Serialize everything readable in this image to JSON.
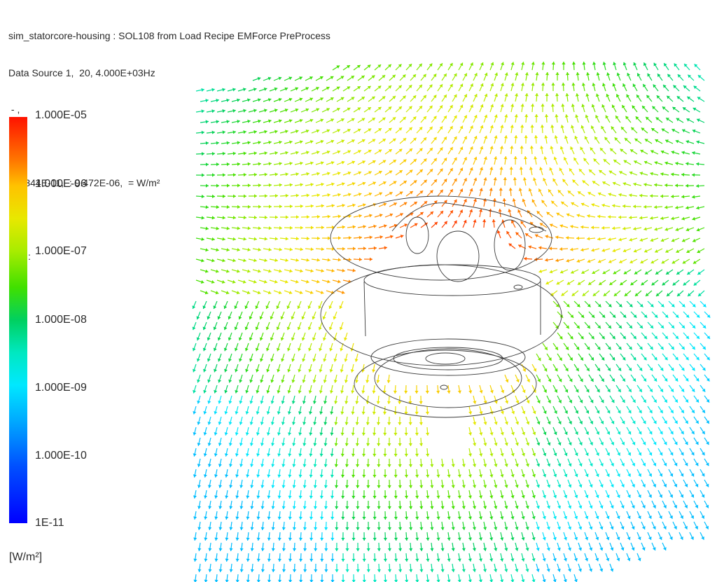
{
  "header": {
    "title": "sim_statorcore-housing : SOL108 from Load Recipe EMForce PreProcess",
    "subtitle": "Data Source 1,  20, 4.000E+03Hz",
    "line3": " - ,",
    "line4": " :",
    "line5": " : 2.344E-11,  : 9.472E-06,  = W/m²",
    "line6": " :",
    "line7": " : - , :"
  },
  "legend": {
    "labels": [
      "1.000E-05",
      "1.000E-06",
      "1.000E-07",
      "1.000E-08",
      "1.000E-09",
      "1.000E-10",
      "1E-11"
    ],
    "unit": "[W/m²]",
    "colors": {
      "max": "#ff1200",
      "high": "#ffc200",
      "mid": "#40e000",
      "low": "#00e8ff",
      "min": "#0000ff"
    }
  },
  "plot": {
    "type": "vector-field",
    "outline_color": "#3a3a3a"
  }
}
